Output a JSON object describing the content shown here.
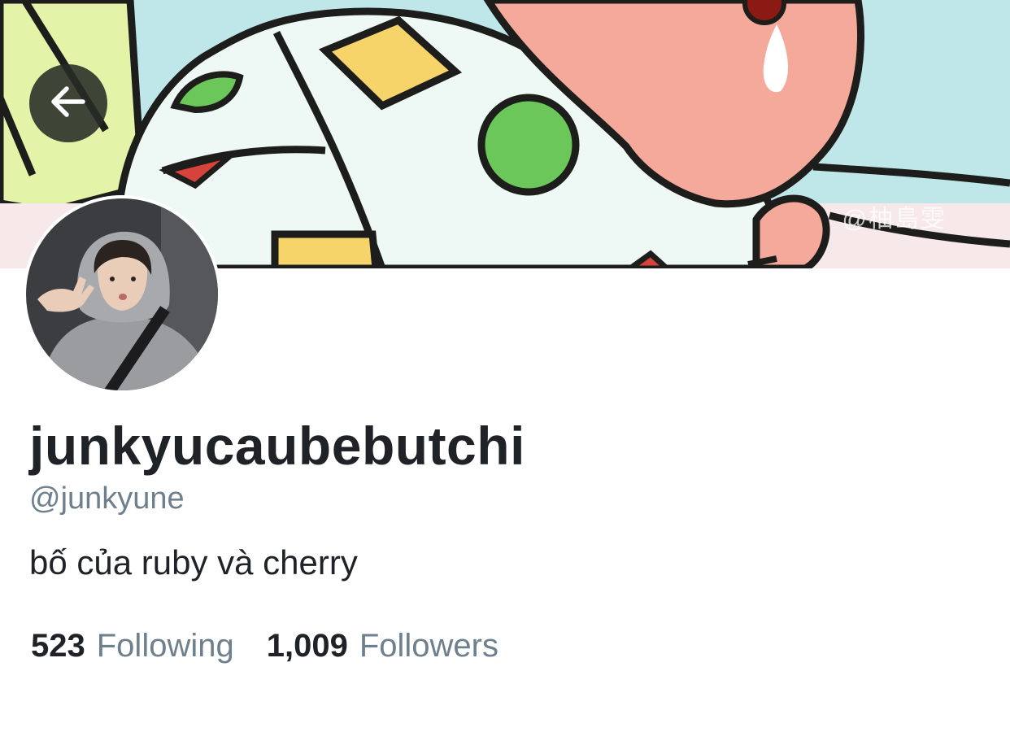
{
  "header": {
    "back_icon": "arrow-left-icon",
    "banner_watermark": "@柚島雯"
  },
  "profile": {
    "display_name": "junkyucaubebutchi",
    "handle": "@junkyune",
    "bio": "bố của ruby và cherry"
  },
  "stats": {
    "following_count": "523",
    "following_label": "Following",
    "followers_count": "1,009",
    "followers_label": "Followers"
  },
  "colors": {
    "text_primary": "#1f2328",
    "text_secondary": "#6e7f8d",
    "background": "#ffffff"
  }
}
